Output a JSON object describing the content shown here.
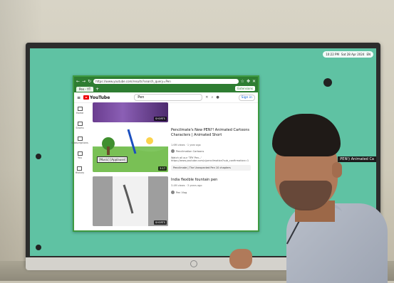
{
  "status_bar": {
    "time": "10:22 PM",
    "date": "Sat 28 Apr 2024",
    "lang": "EN"
  },
  "browser": {
    "url": "https://www.youtube.com/results?search_query=Pen",
    "tab_label": "Pen - YT",
    "extensions_label": "Extensions"
  },
  "youtube": {
    "logo": "YouTube",
    "search_value": "Pen",
    "sign_in": "Sign in",
    "sidebar": [
      "Home",
      "Shorts",
      "Subscriptions",
      "You",
      "History"
    ],
    "shorts_tag": "SHORTS",
    "video1": {
      "title": "Pencilmate's New PEN?! Animated Cartoons Characters | Animated Short",
      "meta": "1.6M views · 1 year ago",
      "channel": "Pencilmation Cartoons",
      "desc": "Watch all our 'TRY Pen...' https://www.youtube.com/c/pencilmation?sub_confirmation=1",
      "chapters": "Pencilmate | The Unexpected Pen   10 chapters",
      "badge": "[Music] [Applause]",
      "duration": "3:17"
    },
    "video2": {
      "title": "India flexible fountain pen",
      "meta": "3.4M views · 3 years ago",
      "channel": "Pen Vlog"
    }
  },
  "edge_text": "PEN!) Animated Ca"
}
